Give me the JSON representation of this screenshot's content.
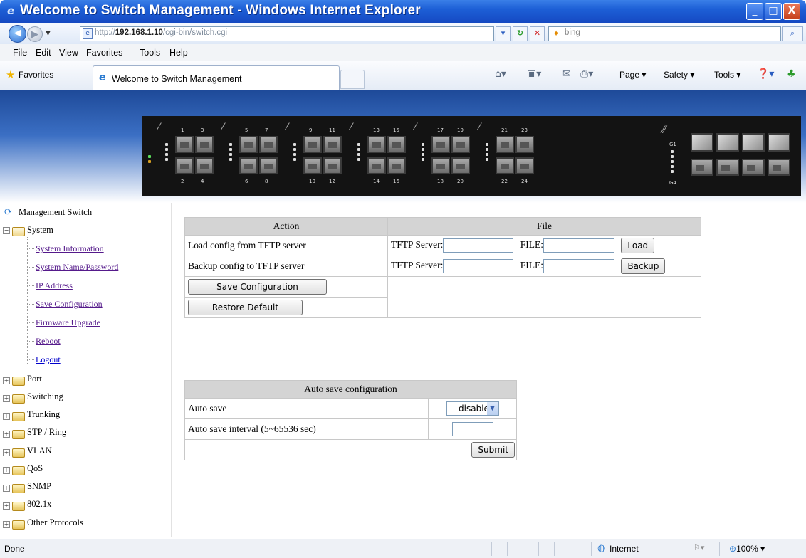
{
  "window": {
    "title": "Welcome to Switch Management - Windows Internet Explorer",
    "minimize": "_",
    "maximize": "□",
    "close": "X"
  },
  "address": {
    "url_prefix": "http://",
    "url_host": "192.168.1.10",
    "url_path": "/cgi-bin/switch.cgi",
    "search_placeholder": "bing"
  },
  "menu": [
    "File",
    "Edit",
    "View",
    "Favorites",
    "Tools",
    "Help"
  ],
  "favbar": {
    "favorites_label": "Favorites",
    "tab_title": "Welcome to Switch Management",
    "commands": [
      "Page ▾",
      "Safety ▾",
      "Tools ▾"
    ]
  },
  "device": {
    "port_groups": [
      {
        "top": [
          "1",
          "3"
        ],
        "bottom": [
          "2",
          "4"
        ]
      },
      {
        "top": [
          "5",
          "7"
        ],
        "bottom": [
          "6",
          "8"
        ]
      },
      {
        "top": [
          "9",
          "11"
        ],
        "bottom": [
          "10",
          "12"
        ]
      },
      {
        "top": [
          "13",
          "15"
        ],
        "bottom": [
          "14",
          "16"
        ]
      },
      {
        "top": [
          "17",
          "19"
        ],
        "bottom": [
          "18",
          "20"
        ]
      },
      {
        "top": [
          "21",
          "23"
        ],
        "bottom": [
          "22",
          "24"
        ]
      }
    ],
    "uplink_labels": [
      "G1",
      "G4"
    ]
  },
  "sidebar": {
    "root": "Management Switch",
    "system": {
      "label": "System",
      "children": [
        "System Information",
        "System Name/Password",
        "IP Address",
        "Save Configuration",
        "Firmware Upgrade",
        "Reboot",
        "Logout"
      ]
    },
    "folders": [
      "Port",
      "Switching",
      "Trunking",
      "STP / Ring",
      "VLAN",
      "QoS",
      "SNMP",
      "802.1x",
      "Other Protocols"
    ]
  },
  "config_table": {
    "col_action": "Action",
    "col_file": "File",
    "rows": [
      {
        "action": "Load config from TFTP server",
        "server_label": "TFTP Server:",
        "file_label": "FILE:",
        "button": "Load"
      },
      {
        "action": "Backup config to TFTP server",
        "server_label": "TFTP Server:",
        "file_label": "FILE:",
        "button": "Backup"
      }
    ],
    "save_button": "Save Configuration",
    "restore_button": "Restore Default"
  },
  "auto_save": {
    "title": "Auto save configuration",
    "auto_save_label": "Auto save",
    "auto_save_value": "disable",
    "interval_label": "Auto save interval (5~65536 sec)",
    "interval_value": "",
    "submit": "Submit"
  },
  "status": {
    "text": "Done",
    "zone": "Internet",
    "zoom": "100%"
  },
  "colors": {
    "title_bar": "#1d5fd6",
    "banner_top": "#1e4a99",
    "table_header": "#d4d4d4",
    "link_visited": "#551a8b"
  }
}
